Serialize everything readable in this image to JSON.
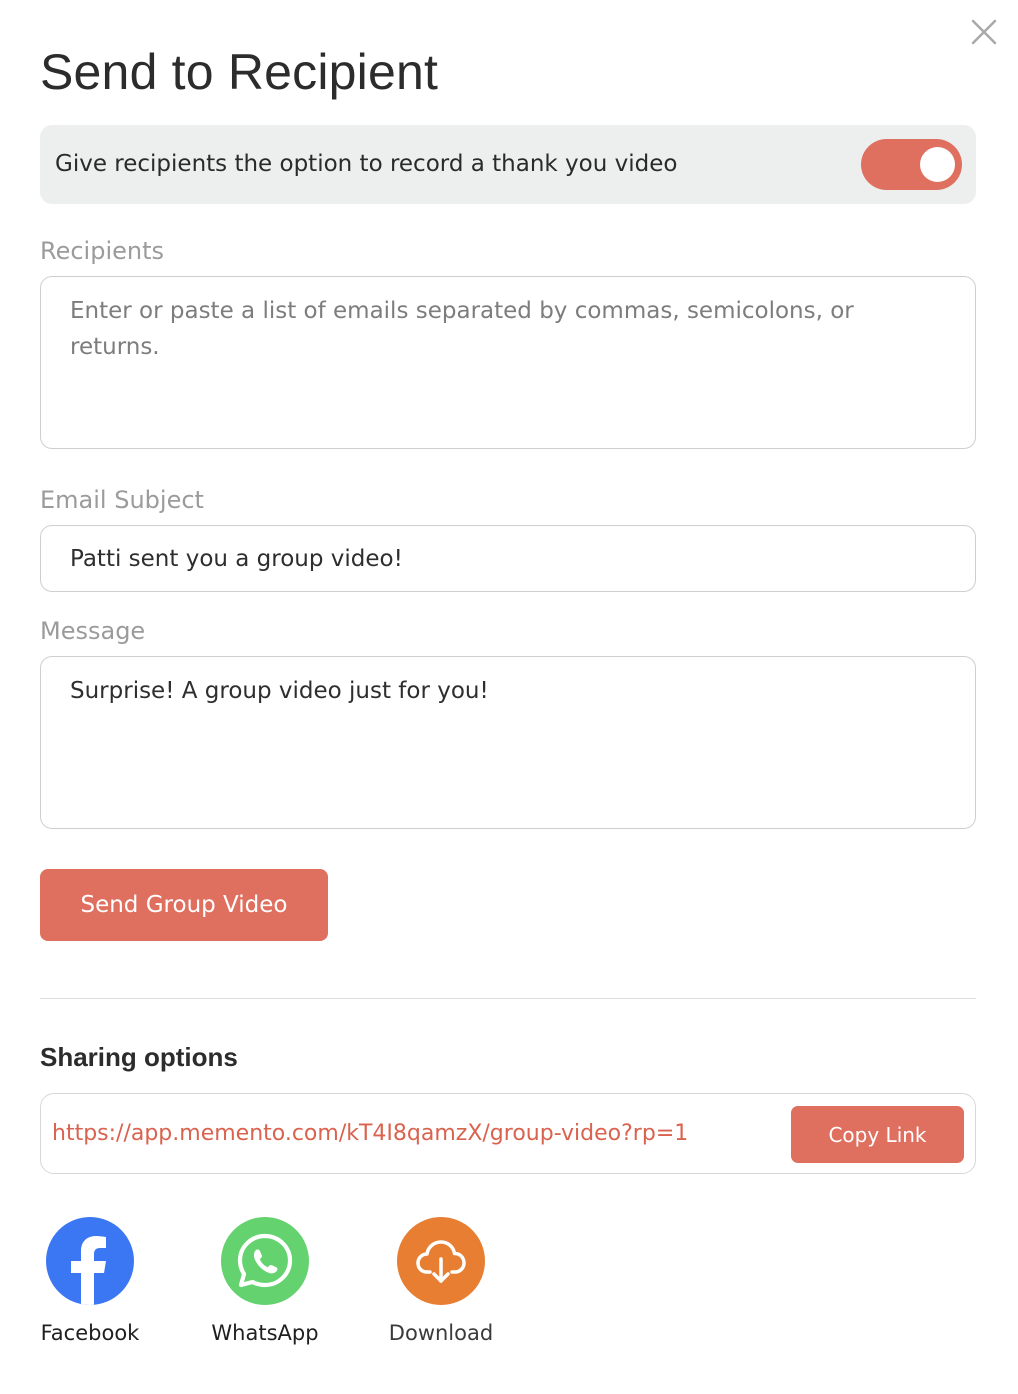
{
  "dialog": {
    "title": "Send to Recipient",
    "close_icon": "close-icon"
  },
  "thank_you_toggle": {
    "label": "Give recipients the option to record a thank you video",
    "enabled": true,
    "color": "#df7060"
  },
  "recipients": {
    "label": "Recipients",
    "value": "",
    "placeholder": "Enter or paste a list of emails separated by commas, semicolons, or returns."
  },
  "email_subject": {
    "label": "Email Subject",
    "value": "Patti sent you a group video!"
  },
  "message": {
    "label": "Message",
    "value": "Surprise! A group video just for you!"
  },
  "send_button": {
    "label": "Send Group Video"
  },
  "sharing": {
    "heading": "Sharing options",
    "link": "https://app.memento.com/kT4I8qamzX/group-video?rp=1",
    "copy_label": "Copy Link",
    "options": [
      {
        "label": "Facebook",
        "icon": "facebook-icon",
        "color": "#3b77f3"
      },
      {
        "label": "WhatsApp",
        "icon": "whatsapp-icon",
        "color": "#64d26e"
      },
      {
        "label": "Download",
        "icon": "cloud-download-icon",
        "color": "#e77e32"
      }
    ]
  },
  "colors": {
    "accent": "#df7060",
    "link": "#d9634f"
  }
}
